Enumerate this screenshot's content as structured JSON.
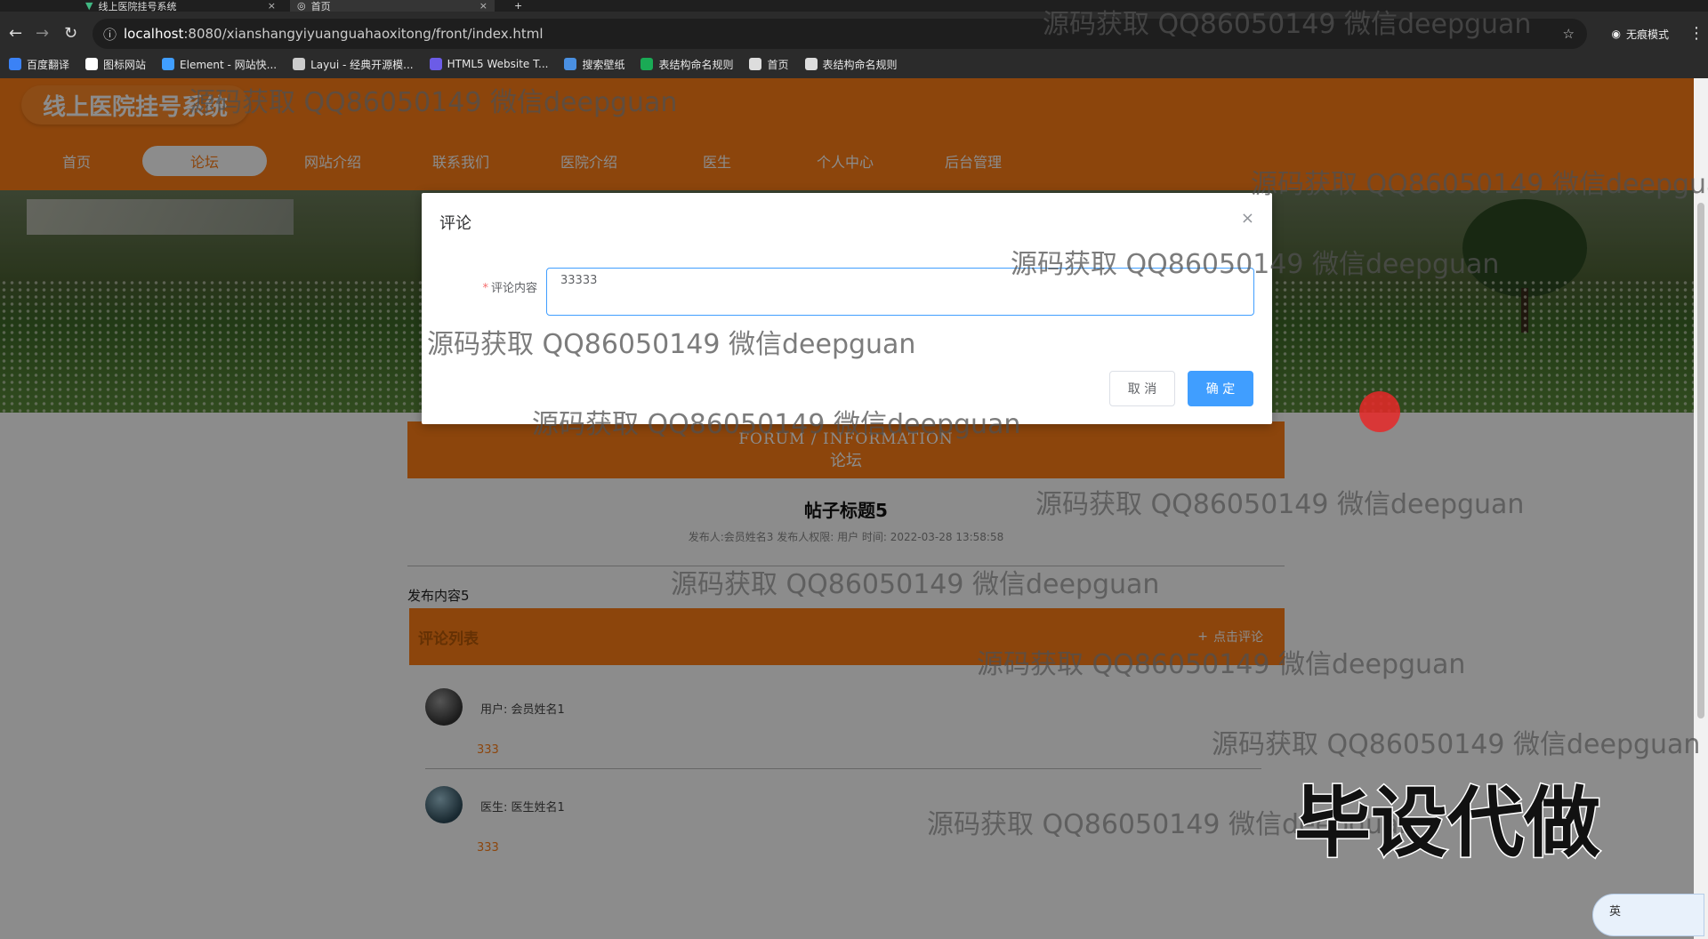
{
  "browser": {
    "tabs": [
      {
        "label": "线上医院挂号系统"
      },
      {
        "label": "首页"
      }
    ],
    "url_host": "localhost",
    "url_rest": ":8080/xianshangyiyuanguahaoxitong/front/index.html",
    "incognito_label": "无痕模式",
    "bookmarks": [
      {
        "label": "百度翻译",
        "color": "#3b82f6"
      },
      {
        "label": "图标网站",
        "color": "#ffffff"
      },
      {
        "label": "Element - 网站快...",
        "color": "#409eff"
      },
      {
        "label": "Layui - 经典开源模...",
        "color": "#cccccc"
      },
      {
        "label": "HTML5 Website T...",
        "color": "#6c5ce7"
      },
      {
        "label": "搜索壁纸",
        "color": "#4a90e2"
      },
      {
        "label": "表结构命名规则",
        "color": "#1aaa55"
      },
      {
        "label": "首页",
        "color": "#dddddd"
      },
      {
        "label": "表结构命名规则",
        "color": "#dddddd"
      }
    ]
  },
  "site": {
    "title": "线上医院挂号系统",
    "nav": [
      {
        "label": "首页"
      },
      {
        "label": "论坛"
      },
      {
        "label": "网站介绍"
      },
      {
        "label": "联系我们"
      },
      {
        "label": "医院介绍"
      },
      {
        "label": "医生"
      },
      {
        "label": "个人中心"
      },
      {
        "label": "后台管理"
      }
    ],
    "active_nav": "论坛"
  },
  "forum": {
    "heading_en": "FORUM / INFORMATION",
    "heading_cn": "论坛",
    "post_title": "帖子标题5",
    "post_meta": "发布人:会员姓名3   发布人权限: 用户   时间: 2022-03-28 13:58:58",
    "post_body": "发布内容5",
    "comment_list_label": "评论列表",
    "add_comment_label": "点击评论",
    "comments": [
      {
        "who": "用户: 会员姓名1",
        "text": "333"
      },
      {
        "who": "医生: 医生姓名1",
        "text": "333"
      }
    ]
  },
  "dialog": {
    "title": "评论",
    "field_label": "评论内容",
    "field_value": "33333",
    "cancel_label": "取 消",
    "ok_label": "确 定"
  },
  "watermarks": {
    "text": "源码获取 QQ86050149 微信deepguan",
    "text_cut": "源码获取 QQ86050149 微信deepgua",
    "stamp": "毕设代做"
  },
  "ime": {
    "label": "英"
  },
  "colors": {
    "accent": "#ff7f17",
    "primary": "#409eff"
  }
}
